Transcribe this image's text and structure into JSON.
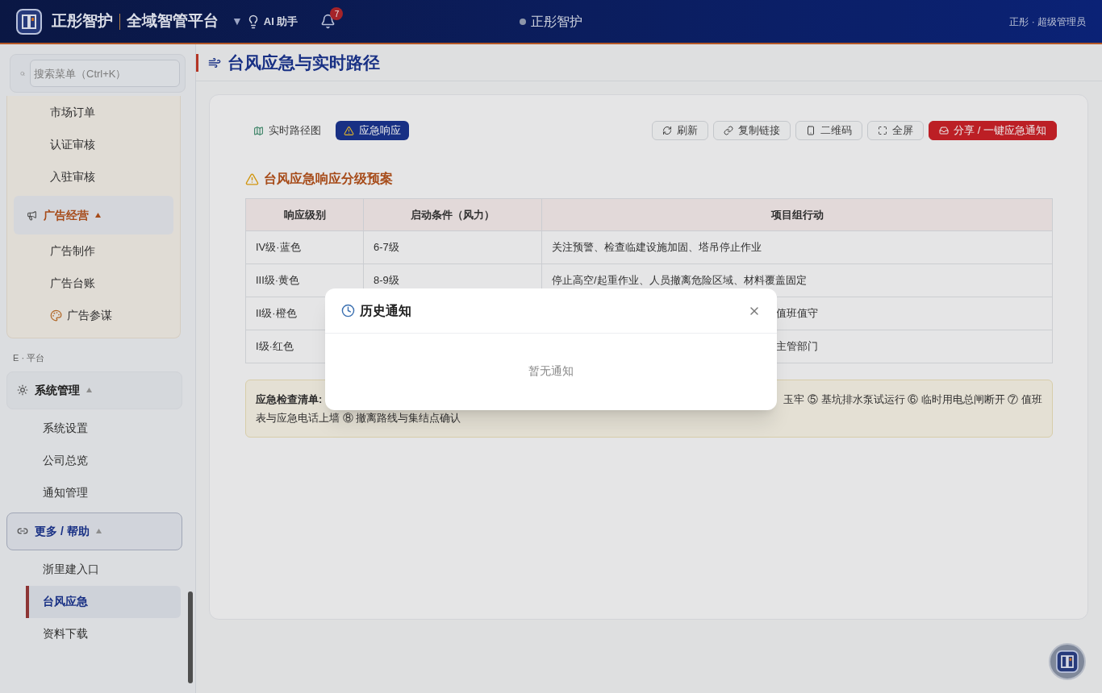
{
  "header": {
    "brand": "正彤智护",
    "platform": "全域智管平台",
    "dropdown": "▼",
    "assistant": "AI 助手",
    "notification_count": "7",
    "center_title": "正彤智护",
    "user": "正彤 · 超级管理员"
  },
  "sidebar": {
    "search": {
      "placeholder": "搜索菜单（Ctrl+K）"
    },
    "panel": {
      "items": [
        {
          "label": "市场订单",
          "selected": false
        },
        {
          "label": "认证审核",
          "selected": false
        },
        {
          "label": "入驻审核",
          "selected": false
        }
      ],
      "group": {
        "label": "广告经营",
        "expanded": true,
        "active": true,
        "children": [
          {
            "label": "广告制作",
            "selected": false
          },
          {
            "label": "广告台账",
            "selected": false
          },
          {
            "label": "广告参谋",
            "selected": false
          }
        ]
      }
    },
    "section_label": "E · 平台",
    "groups": [
      {
        "label": "系统管理",
        "expanded": true,
        "active": false,
        "children": [
          {
            "label": "系统设置",
            "selected": false
          },
          {
            "label": "公司总览",
            "selected": false
          },
          {
            "label": "通知管理",
            "selected": false
          }
        ]
      },
      {
        "label": "更多 / 帮助",
        "expanded": true,
        "active": true,
        "children": [
          {
            "label": "浙里建入口",
            "selected": false
          },
          {
            "label": "台风应急",
            "selected": true
          },
          {
            "label": "资料下载",
            "selected": false
          }
        ]
      }
    ]
  },
  "page_title": "台风应急与实时路径",
  "tabs": [
    {
      "label": "实时路径图",
      "selected": false
    },
    {
      "label": "应急响应",
      "selected": true
    }
  ],
  "actions": [
    {
      "label": "刷新",
      "kind": "plain"
    },
    {
      "label": "复制链接",
      "kind": "plain"
    },
    {
      "label": "二维码",
      "kind": "plain"
    },
    {
      "label": "全屏",
      "kind": "plain"
    },
    {
      "label": "分享 / 一键应急通知",
      "kind": "primary"
    }
  ],
  "section_title": "台风应急响应分级预案",
  "table": {
    "columns": [
      "响应级别",
      "启动条件（风力）",
      "项目组行动"
    ],
    "rows": [
      {
        "level": "IV级·蓝色",
        "condition": "6-7级",
        "action": "关注预警、检查临建设施加固、塔吊停止作业",
        "action_hidden_start": false
      },
      {
        "level": "III级·黄色",
        "condition": "8-9级",
        "action": "停止高空/起重作业、人员撤离危险区域、材料覆盖固定",
        "action_hidden_start": false
      },
      {
        "level": "II级·橙色",
        "action": "值班值守",
        "action_hidden_start": true
      },
      {
        "level": "I级·红色",
        "action": "主管部门",
        "action_hidden_start": true
      }
    ]
  },
  "checklist": {
    "label": "应急检查清单:",
    "line_1_end": "玉牢 ⑤ 基坑排水泵试运行 ⑥ 临时用电总闸断开 ⑦ 值班",
    "line_2": "表与应急电话上墙 ⑧ 撤离路线与集结点确认"
  },
  "modal": {
    "title": "历史通知",
    "empty_text": "暂无通知"
  }
}
